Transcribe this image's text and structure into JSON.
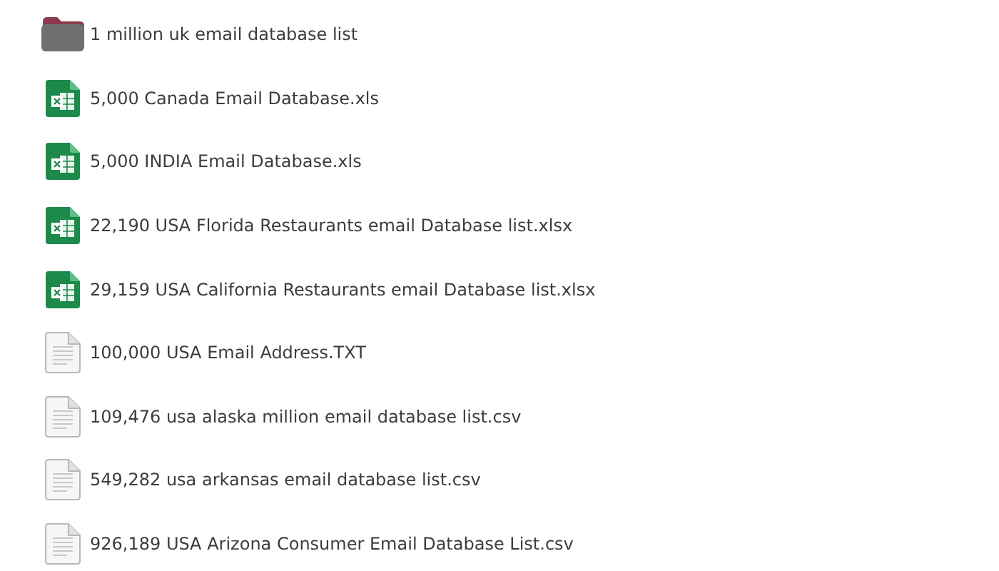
{
  "files": [
    {
      "kind": "folder",
      "name": "1 million uk email database list"
    },
    {
      "kind": "spreadsheet",
      "name": "5,000 Canada Email Database.xls"
    },
    {
      "kind": "spreadsheet",
      "name": "5,000 INDIA Email Database.xls"
    },
    {
      "kind": "spreadsheet",
      "name": "22,190 USA Florida Restaurants email Database list.xlsx"
    },
    {
      "kind": "spreadsheet",
      "name": "29,159 USA California Restaurants email Database list.xlsx"
    },
    {
      "kind": "text",
      "name": "100,000 USA Email Address.TXT"
    },
    {
      "kind": "text",
      "name": "109,476 usa alaska million email database list.csv"
    },
    {
      "kind": "text",
      "name": "549,282 usa arkansas email database list.csv"
    },
    {
      "kind": "text",
      "name": "926,189 USA Arizona Consumer Email Database List.csv"
    }
  ]
}
